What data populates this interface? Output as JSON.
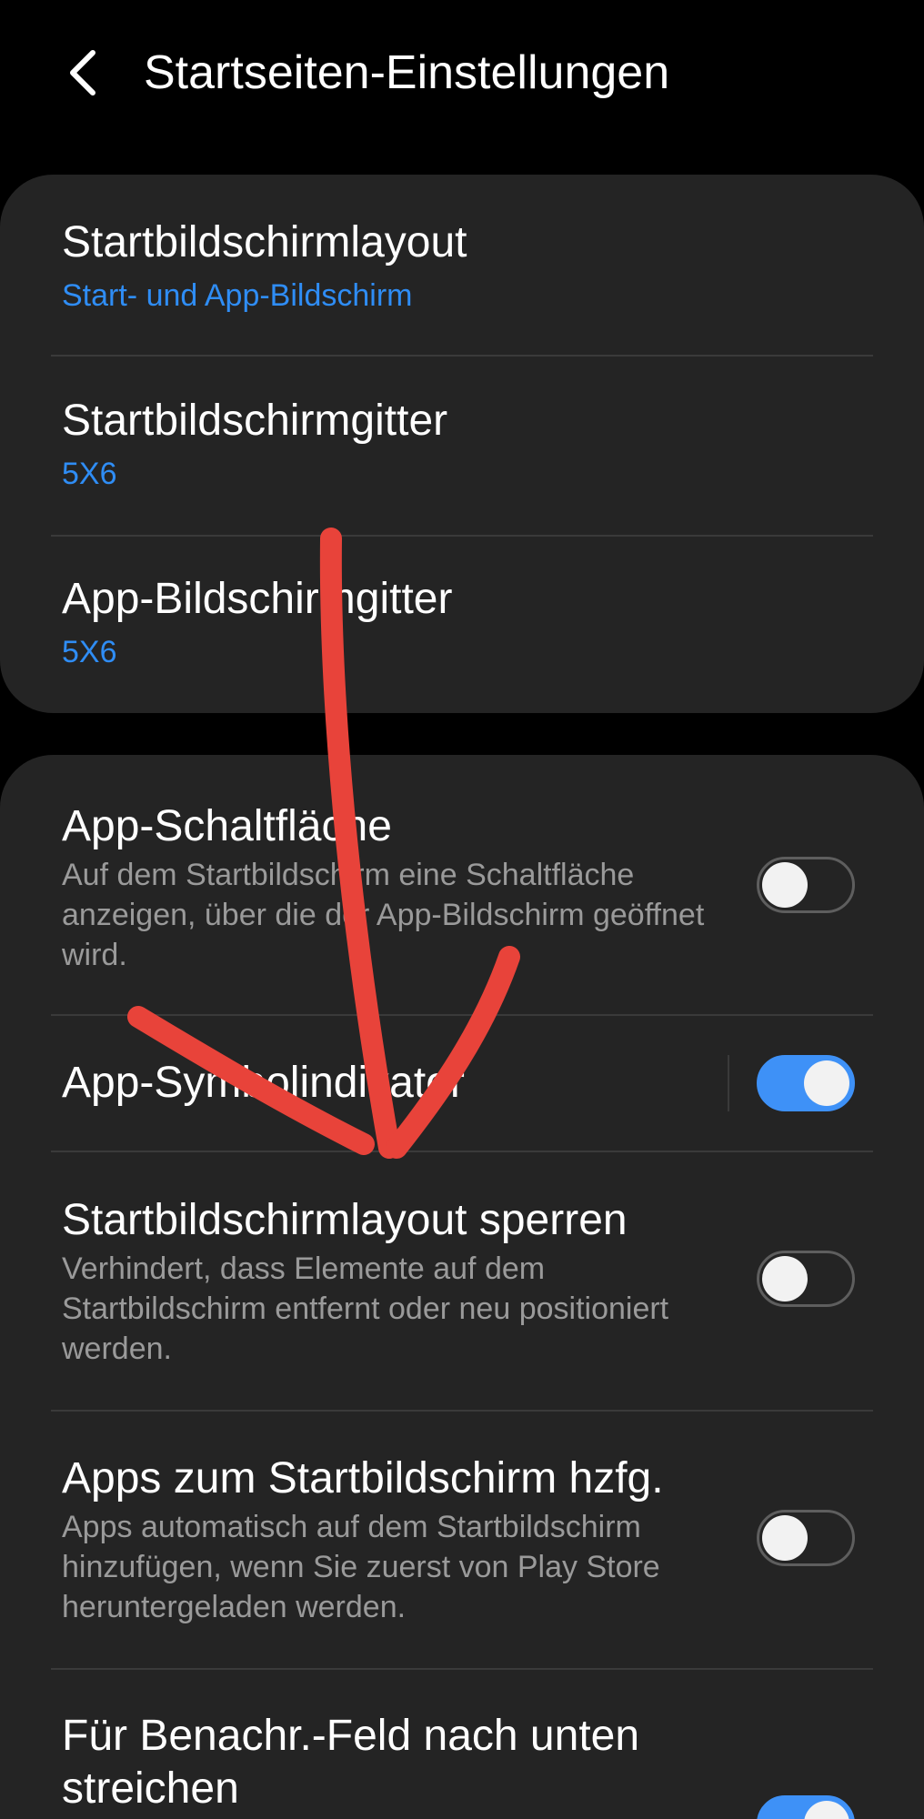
{
  "header": {
    "back_icon": "chevron-left-icon",
    "title": "Startseiten-Einstellungen"
  },
  "group1": {
    "items": [
      {
        "title": "Startbildschirmlayout",
        "value": "Start- und App-Bildschirm"
      },
      {
        "title": "Startbildschirmgitter",
        "value": "5X6"
      },
      {
        "title": "App-Bildschirmgitter",
        "value": "5X6"
      }
    ]
  },
  "group2": {
    "items": [
      {
        "title": "App-Schaltfläche",
        "description": "Auf dem Startbildschirm eine Schaltfläche anzeigen, über die der App-Bildschirm geöffnet wird.",
        "toggle": false
      },
      {
        "title": "App-Symbolindikator",
        "toggle": true
      },
      {
        "title": "Startbildschirmlayout sperren",
        "description": "Verhindert, dass Elemente auf dem Startbildschirm entfernt oder neu positioniert werden.",
        "toggle": false
      },
      {
        "title": "Apps zum Startbildschirm hzfg.",
        "description": "Apps automatisch auf dem Startbildschirm hinzufügen, wenn Sie zuerst von Play Store heruntergeladen werden.",
        "toggle": false
      },
      {
        "title": "Für Benachr.-Feld nach unten streichen",
        "toggle": true
      }
    ]
  },
  "colors": {
    "background": "#000000",
    "card": "#242424",
    "accent": "#2f8df5",
    "toggle_on": "#3e91f7",
    "annotation": "#e8433a"
  },
  "annotation": {
    "shape": "hand-drawn-arrow-down"
  }
}
